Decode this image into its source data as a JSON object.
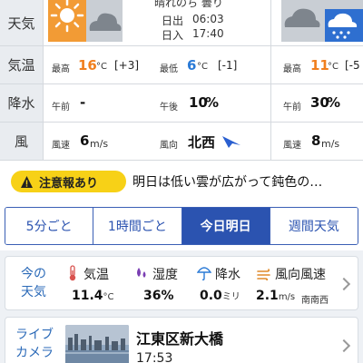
{
  "forecast": {
    "row_labels": {
      "weather": "天気",
      "temp": "気温",
      "precip": "降水",
      "wind": "風"
    },
    "today": {
      "weather_icon": "sun-cloud-icon",
      "weather_text": "晴れのち 曇り",
      "sunrise_label": "日出",
      "sunrise": "06:03",
      "sunset_label": "日入",
      "sunset": "17:40",
      "max_label": "最高",
      "max_temp": "16",
      "max_delta": "[+3]",
      "min_label": "最低",
      "min_temp": "6",
      "min_delta": "[-1]",
      "am_label": "午前",
      "am_precip": "-",
      "pm_label": "午後",
      "pm_precip": "10",
      "precip_unit": "%",
      "windspeed_label": "風速",
      "windspeed": "6",
      "windspeed_unit": "m/s",
      "winddir_label": "風向",
      "winddir": "北西",
      "temp_unit": "°C"
    },
    "tomorrow": {
      "weather_icon": "cloud-rain-icon",
      "max_label": "最高",
      "max_temp": "11",
      "max_delta": "[-5",
      "am_label": "午前",
      "am_precip": "30",
      "precip_unit": "%",
      "windspeed_label": "風速",
      "windspeed": "8",
      "windspeed_unit": "m/s",
      "temp_unit": "°C"
    }
  },
  "warning": {
    "badge_label": "注意報あり",
    "message": "明日は低い雲が広がって鈍色の…"
  },
  "tabs": [
    {
      "label": "5分ごと",
      "active": false
    },
    {
      "label": "1時間ごと",
      "active": false
    },
    {
      "label": "今日明日",
      "active": true
    },
    {
      "label": "週間天気",
      "active": false
    }
  ],
  "now": {
    "title": "今の天気",
    "temp_label": "気温",
    "temp_value": "11.4",
    "temp_unit": "°C",
    "humidity_label": "湿度",
    "humidity_value": "36",
    "humidity_unit": "%",
    "precip_label": "降水",
    "precip_value": "0.0",
    "precip_unit": "ミリ",
    "wind_label": "風向風速",
    "wind_value": "2.1",
    "wind_unit": "m/s",
    "wind_dir": "南南西"
  },
  "camera": {
    "title": "ライブカメラ",
    "location": "江東区新大橋",
    "time": "17:53"
  },
  "colors": {
    "accent_blue": "#2b53b0",
    "title_blue": "#2b6ab8",
    "warning_yellow": "#f7d117",
    "temp_orange": "#f07f1e",
    "temp_blue": "#2a7ad6"
  }
}
